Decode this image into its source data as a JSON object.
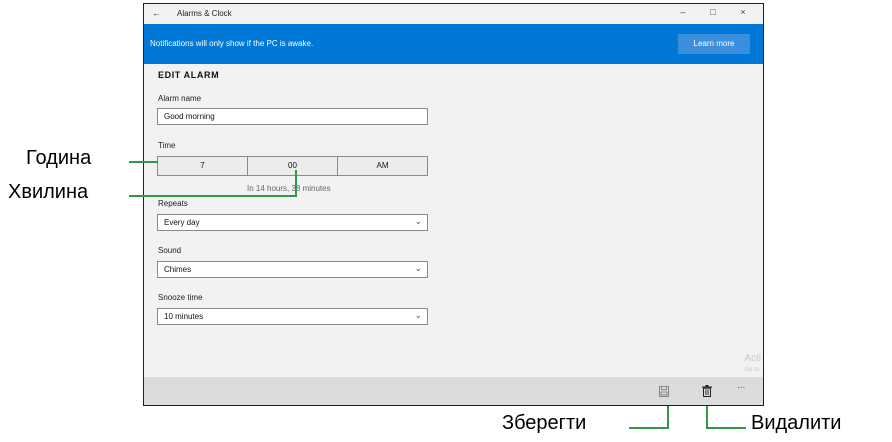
{
  "window": {
    "title": "Alarms & Clock",
    "back_glyph": "←",
    "minimize_glyph": "–",
    "maximize_glyph": "□",
    "close_glyph": "×"
  },
  "notification": {
    "message": "Notifications will only show if the PC is awake.",
    "learn_more": "Learn more"
  },
  "form": {
    "heading": "EDIT ALARM",
    "alarm_name_label": "Alarm name",
    "alarm_name_value": "Good morning",
    "time_label": "Time",
    "hour": "7",
    "minute": "00",
    "period": "AM",
    "time_hint": "In 14 hours, 38 minutes",
    "repeats_label": "Repeats",
    "repeats_value": "Every day",
    "sound_label": "Sound",
    "sound_value": "Chimes",
    "snooze_label": "Snooze time",
    "snooze_value": "10 minutes"
  },
  "bottom_bar": {
    "more_glyph": "..."
  },
  "watermark": {
    "line1": "Acti",
    "line2": "Go to"
  },
  "annotations": {
    "hour": "Година",
    "minute": "Хвилина",
    "save": "Зберегти",
    "delete": "Видалити"
  },
  "colors": {
    "accent": "#0078d7",
    "annotation_line": "#2e9a46"
  }
}
